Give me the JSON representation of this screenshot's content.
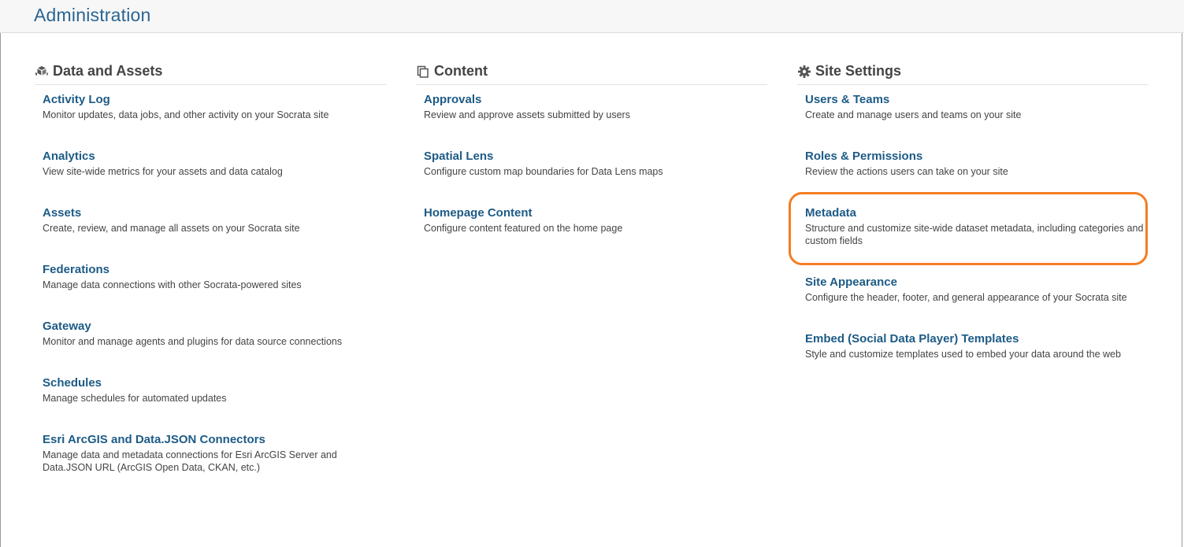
{
  "header": {
    "title": "Administration"
  },
  "columns": [
    {
      "title": "Data and Assets",
      "icon": "cubes-icon",
      "items": [
        {
          "title": "Activity Log",
          "description": "Monitor updates, data jobs, and other activity on your Socrata site"
        },
        {
          "title": "Analytics",
          "description": "View site-wide metrics for your assets and data catalog"
        },
        {
          "title": "Assets",
          "description": "Create, review, and manage all assets on your Socrata site"
        },
        {
          "title": "Federations",
          "description": "Manage data connections with other Socrata-powered sites"
        },
        {
          "title": "Gateway",
          "description": "Monitor and manage agents and plugins for data source connections"
        },
        {
          "title": "Schedules",
          "description": "Manage schedules for automated updates"
        },
        {
          "title": "Esri ArcGIS and Data.JSON Connectors",
          "description": "Manage data and metadata connections for Esri ArcGIS Server and Data.JSON URL (ArcGIS Open Data, CKAN, etc.)"
        }
      ]
    },
    {
      "title": "Content",
      "icon": "copy-icon",
      "items": [
        {
          "title": "Approvals",
          "description": "Review and approve assets submitted by users"
        },
        {
          "title": "Spatial Lens",
          "description": "Configure custom map boundaries for Data Lens maps"
        },
        {
          "title": "Homepage Content",
          "description": "Configure content featured on the home page"
        }
      ]
    },
    {
      "title": "Site Settings",
      "icon": "gear-icon",
      "items": [
        {
          "title": "Users & Teams",
          "description": "Create and manage users and teams on your site"
        },
        {
          "title": "Roles & Permissions",
          "description": "Review the actions users can take on your site"
        },
        {
          "title": "Metadata",
          "description": "Structure and customize site-wide dataset metadata, including categories and custom fields"
        },
        {
          "title": "Site Appearance",
          "description": "Configure the header, footer, and general appearance of your Socrata site"
        },
        {
          "title": "Embed (Social Data Player) Templates",
          "description": "Style and customize templates used to embed your data around the web"
        }
      ]
    }
  ],
  "highlight": {
    "target": "Metadata",
    "color": "#f47d22"
  },
  "colors": {
    "link": "#1d5b86",
    "title": "#2a6592",
    "text": "#444444"
  }
}
